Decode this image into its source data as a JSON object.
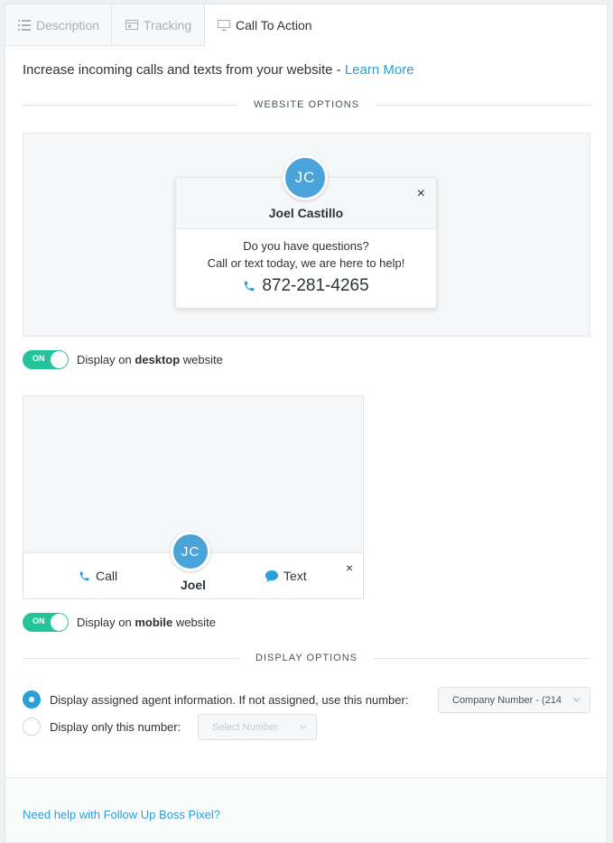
{
  "tabs": [
    {
      "label": "Description",
      "icon": "list-icon",
      "active": false
    },
    {
      "label": "Tracking",
      "icon": "browser-icon",
      "active": false
    },
    {
      "label": "Call To Action",
      "icon": "monitor-icon",
      "active": true
    }
  ],
  "intro": {
    "text": "Increase incoming calls and texts from your website - ",
    "link": "Learn More"
  },
  "website_options": {
    "label": "WEBSITE OPTIONS",
    "desktop_preview": {
      "initials": "JC",
      "name": "Joel Castillo",
      "close": "×",
      "line1": "Do you have questions?",
      "line2": "Call or text today, we are here to help!",
      "phone": "872-281-4265"
    },
    "desktop_toggle": {
      "state": "ON",
      "prefix": "Display on ",
      "bold": "desktop",
      "suffix": " website"
    },
    "mobile_preview": {
      "initials": "JC",
      "name": "Joel",
      "call": "Call",
      "text": "Text",
      "close": "×"
    },
    "mobile_toggle": {
      "state": "ON",
      "prefix": "Display on ",
      "bold": "mobile",
      "suffix": " website"
    }
  },
  "display_options": {
    "label": "DISPLAY OPTIONS",
    "option1": {
      "label": "Display assigned agent information. If not assigned, use this number:",
      "checked": true,
      "select": "Company Number - (214"
    },
    "option2": {
      "label": "Display only this number:",
      "checked": false,
      "select": "Select Number"
    }
  },
  "footer": {
    "link": "Need help with Follow Up Boss Pixel?"
  },
  "colors": {
    "accent": "#2a9fd8",
    "toggle_on": "#23c49a",
    "avatar": "#4aa3d9"
  }
}
